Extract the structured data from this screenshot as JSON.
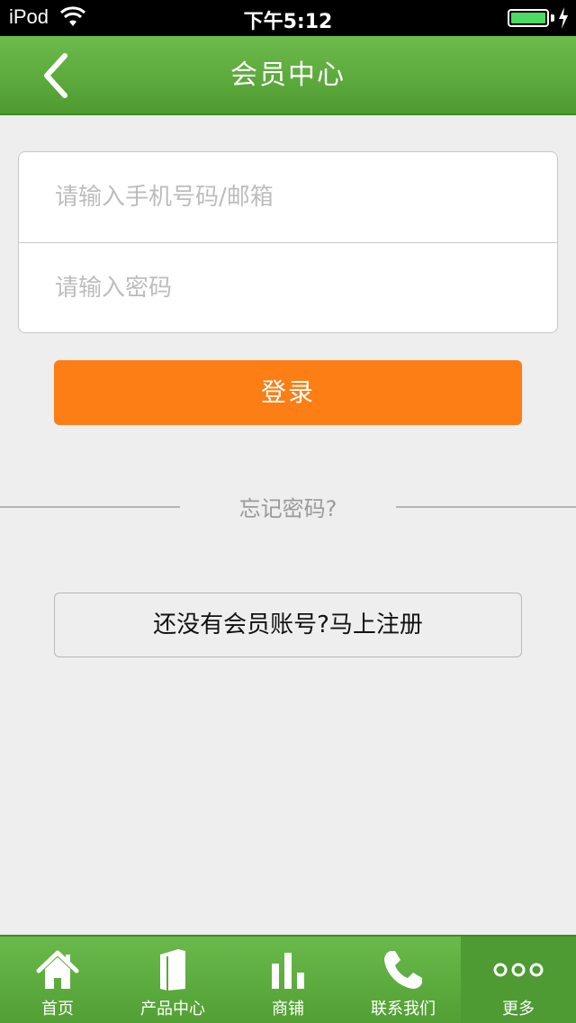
{
  "status_bar": {
    "carrier": "iPod",
    "time": "下午5:12",
    "battery_level": 1.0
  },
  "navbar": {
    "title": "会员中心",
    "back_icon": "chevron-left-icon"
  },
  "login_form": {
    "account_placeholder": "请输入手机号码/邮箱",
    "password_placeholder": "请输入密码",
    "login_label": "登录"
  },
  "forgot_label": "忘记密码?",
  "register_label": "还没有会员账号?马上注册",
  "tabbar": {
    "items": [
      {
        "label": "首页",
        "icon": "home-icon"
      },
      {
        "label": "产品中心",
        "icon": "book-icon"
      },
      {
        "label": "商铺",
        "icon": "bar-chart-icon"
      },
      {
        "label": "联系我们",
        "icon": "phone-icon"
      },
      {
        "label": "更多",
        "icon": "more-icon"
      }
    ],
    "active_index": 4
  },
  "colors": {
    "accent_green": "#5aa93c",
    "login_orange": "#fc7e14",
    "battery_green": "#4cd964"
  }
}
